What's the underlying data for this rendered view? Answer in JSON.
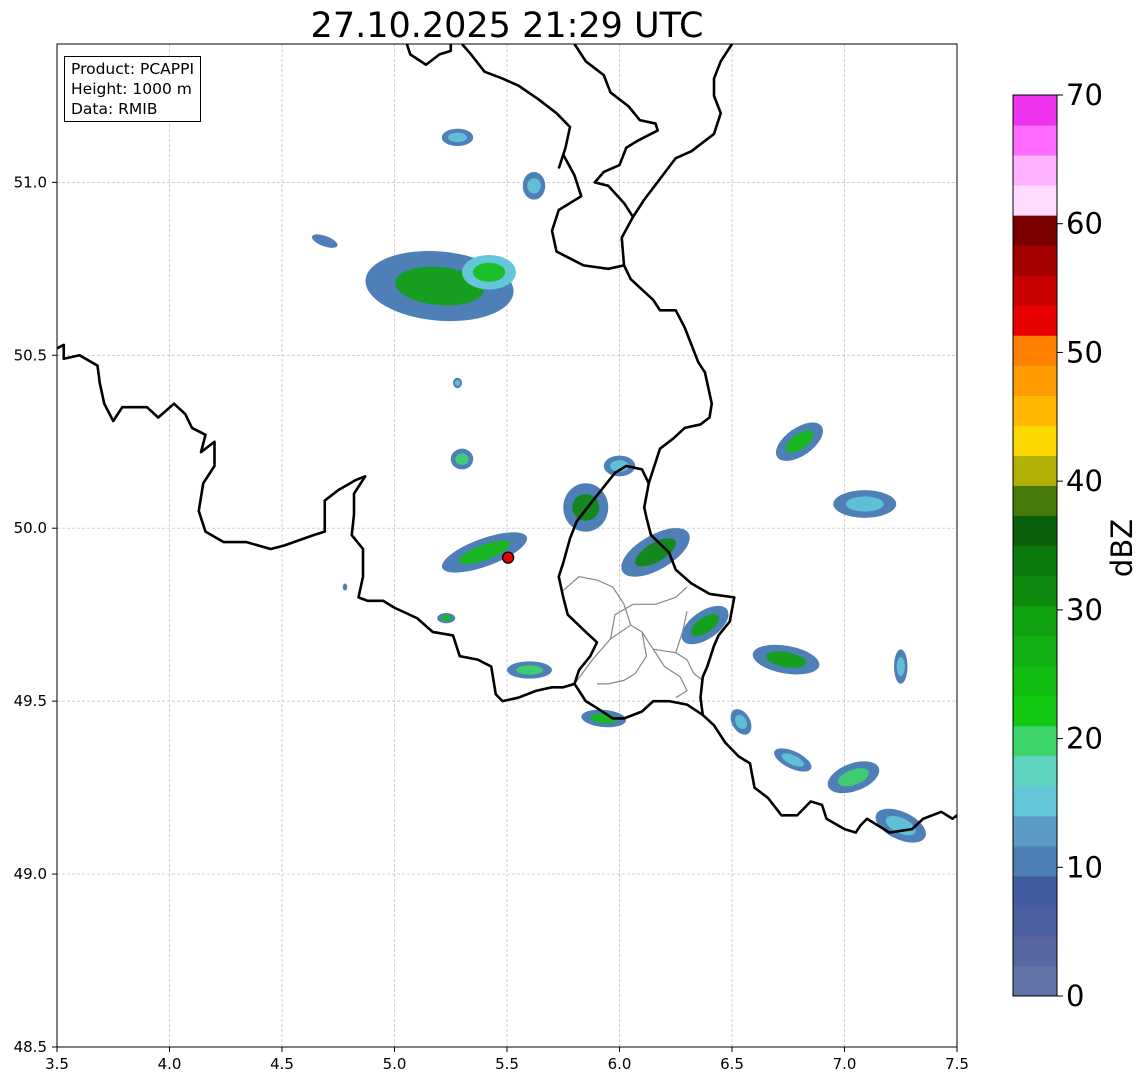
{
  "map": {
    "title": "27.10.2025 21:29 UTC",
    "info": {
      "product": "Product: PCAPPI",
      "height": "Height: 1000 m",
      "data": "Data: RMIB"
    },
    "lon_range": [
      3.5,
      7.5
    ],
    "lat_range": [
      48.5,
      51.4
    ],
    "lon_ticks": [
      3.5,
      4.0,
      4.5,
      5.0,
      5.5,
      6.0,
      6.5,
      7.0,
      7.5
    ],
    "lat_ticks": [
      48.5,
      49.0,
      49.5,
      50.0,
      50.5,
      51.0
    ],
    "grid": true,
    "radar_site": {
      "lon": 5.505,
      "lat": 49.915,
      "color": "#e60000"
    },
    "borders": [
      [
        [
          3.5,
          50.52
        ],
        [
          3.53,
          50.53
        ],
        [
          3.53,
          50.49
        ],
        [
          3.6,
          50.5
        ],
        [
          3.68,
          50.47
        ],
        [
          3.69,
          50.42
        ],
        [
          3.71,
          50.36
        ],
        [
          3.75,
          50.31
        ],
        [
          3.79,
          50.35
        ],
        [
          3.9,
          50.35
        ],
        [
          3.95,
          50.32
        ],
        [
          4.02,
          50.36
        ],
        [
          4.07,
          50.33
        ],
        [
          4.1,
          50.29
        ],
        [
          4.16,
          50.27
        ],
        [
          4.14,
          50.22
        ],
        [
          4.2,
          50.25
        ],
        [
          4.2,
          50.18
        ],
        [
          4.15,
          50.13
        ],
        [
          4.13,
          50.05
        ],
        [
          4.16,
          49.99
        ],
        [
          4.24,
          49.96
        ],
        [
          4.34,
          49.96
        ],
        [
          4.45,
          49.94
        ],
        [
          4.51,
          49.95
        ],
        [
          4.64,
          49.98
        ],
        [
          4.69,
          49.99
        ],
        [
          4.69,
          50.08
        ],
        [
          4.75,
          50.11
        ],
        [
          4.83,
          50.14
        ],
        [
          4.87,
          50.15
        ],
        [
          4.82,
          50.1
        ],
        [
          4.82,
          50.04
        ],
        [
          4.81,
          49.98
        ],
        [
          4.86,
          49.94
        ],
        [
          4.86,
          49.86
        ],
        [
          4.84,
          49.8
        ],
        [
          4.88,
          49.79
        ],
        [
          4.95,
          49.79
        ],
        [
          5.0,
          49.77
        ],
        [
          5.1,
          49.74
        ],
        [
          5.17,
          49.7
        ],
        [
          5.26,
          49.69
        ],
        [
          5.29,
          49.63
        ],
        [
          5.37,
          49.62
        ],
        [
          5.43,
          49.6
        ],
        [
          5.45,
          49.52
        ],
        [
          5.48,
          49.5
        ],
        [
          5.55,
          49.51
        ],
        [
          5.63,
          49.53
        ],
        [
          5.7,
          49.54
        ],
        [
          5.75,
          49.54
        ],
        [
          5.8,
          49.55
        ],
        [
          5.85,
          49.5
        ],
        [
          5.9,
          49.48
        ],
        [
          5.97,
          49.45
        ],
        [
          6.02,
          49.45
        ],
        [
          6.1,
          49.47
        ],
        [
          6.15,
          49.5
        ],
        [
          6.22,
          49.5
        ],
        [
          6.3,
          49.49
        ],
        [
          6.37,
          49.46
        ],
        [
          6.42,
          49.43
        ],
        [
          6.47,
          49.38
        ],
        [
          6.53,
          49.34
        ],
        [
          6.58,
          49.32
        ],
        [
          6.6,
          49.25
        ],
        [
          6.66,
          49.22
        ],
        [
          6.72,
          49.17
        ],
        [
          6.79,
          49.17
        ],
        [
          6.85,
          49.21
        ],
        [
          6.9,
          49.2
        ],
        [
          6.92,
          49.16
        ],
        [
          7.0,
          49.13
        ],
        [
          7.05,
          49.12
        ],
        [
          7.07,
          49.14
        ],
        [
          7.1,
          49.16
        ],
        [
          7.2,
          49.12
        ],
        [
          7.3,
          49.13
        ],
        [
          7.35,
          49.16
        ],
        [
          7.43,
          49.18
        ],
        [
          7.48,
          49.16
        ],
        [
          7.5,
          49.17
        ]
      ],
      [
        [
          5.8,
          51.4
        ],
        [
          5.85,
          51.35
        ],
        [
          5.93,
          51.31
        ],
        [
          5.96,
          51.26
        ],
        [
          6.04,
          51.22
        ],
        [
          6.09,
          51.18
        ],
        [
          6.16,
          51.17
        ],
        [
          6.17,
          51.15
        ],
        [
          6.08,
          51.12
        ],
        [
          6.03,
          51.1
        ],
        [
          6.0,
          51.05
        ],
        [
          5.93,
          51.03
        ],
        [
          5.89,
          51.0
        ],
        [
          5.95,
          50.99
        ],
        [
          6.02,
          50.94
        ],
        [
          6.06,
          50.9
        ],
        [
          6.01,
          50.84
        ],
        [
          6.02,
          50.76
        ],
        [
          6.05,
          50.72
        ],
        [
          6.15,
          50.66
        ],
        [
          6.18,
          50.63
        ],
        [
          6.25,
          50.63
        ],
        [
          6.29,
          50.58
        ],
        [
          6.35,
          50.48
        ],
        [
          6.38,
          50.45
        ],
        [
          6.41,
          50.36
        ],
        [
          6.4,
          50.32
        ],
        [
          6.36,
          50.3
        ],
        [
          6.29,
          50.29
        ],
        [
          6.24,
          50.26
        ],
        [
          6.18,
          50.23
        ],
        [
          6.15,
          50.17
        ],
        [
          6.13,
          50.13
        ],
        [
          6.11,
          50.06
        ],
        [
          6.12,
          50.03
        ],
        [
          6.14,
          49.98
        ],
        [
          6.22,
          49.93
        ],
        [
          6.25,
          49.88
        ],
        [
          6.32,
          49.84
        ],
        [
          6.4,
          49.81
        ],
        [
          6.51,
          49.8
        ],
        [
          6.49,
          49.73
        ],
        [
          6.44,
          49.69
        ],
        [
          6.42,
          49.66
        ],
        [
          6.39,
          49.6
        ],
        [
          6.37,
          49.57
        ],
        [
          6.36,
          49.51
        ],
        [
          6.37,
          49.46
        ]
      ],
      [
        [
          5.8,
          49.55
        ],
        [
          5.82,
          49.59
        ],
        [
          5.87,
          49.63
        ],
        [
          5.9,
          49.67
        ],
        [
          5.85,
          49.7
        ],
        [
          5.77,
          49.75
        ],
        [
          5.75,
          49.8
        ],
        [
          5.73,
          49.86
        ],
        [
          5.75,
          49.9
        ],
        [
          5.78,
          49.97
        ],
        [
          5.81,
          50.02
        ],
        [
          5.87,
          50.07
        ],
        [
          5.98,
          50.16
        ],
        [
          6.03,
          50.18
        ],
        [
          6.1,
          50.17
        ],
        [
          6.13,
          50.13
        ]
      ],
      [
        [
          5.25,
          51.4
        ],
        [
          5.25,
          51.38
        ],
        [
          5.2,
          51.37
        ],
        [
          5.14,
          51.34
        ],
        [
          5.07,
          51.37
        ],
        [
          5.04,
          51.43
        ]
      ],
      [
        [
          5.3,
          51.4
        ],
        [
          5.34,
          51.37
        ],
        [
          5.4,
          51.32
        ],
        [
          5.48,
          51.3
        ],
        [
          5.55,
          51.28
        ],
        [
          5.64,
          51.24
        ],
        [
          5.72,
          51.2
        ],
        [
          5.78,
          51.16
        ],
        [
          5.76,
          51.1
        ],
        [
          5.73,
          51.04
        ]
      ],
      [
        [
          5.75,
          51.08
        ],
        [
          5.8,
          51.02
        ],
        [
          5.83,
          50.96
        ],
        [
          5.73,
          50.92
        ],
        [
          5.7,
          50.86
        ],
        [
          5.72,
          50.8
        ],
        [
          5.78,
          50.78
        ],
        [
          5.84,
          50.76
        ],
        [
          5.95,
          50.75
        ],
        [
          6.02,
          50.76
        ]
      ],
      [
        [
          6.5,
          51.4
        ],
        [
          6.45,
          51.35
        ],
        [
          6.42,
          51.3
        ],
        [
          6.42,
          51.25
        ],
        [
          6.45,
          51.2
        ],
        [
          6.42,
          51.14
        ],
        [
          6.32,
          51.09
        ],
        [
          6.25,
          51.07
        ],
        [
          6.18,
          51.01
        ],
        [
          6.11,
          50.95
        ],
        [
          6.06,
          50.9
        ]
      ]
    ],
    "admin_lines": [
      [
        [
          5.8,
          49.55
        ],
        [
          5.88,
          49.62
        ],
        [
          5.96,
          49.68
        ],
        [
          6.05,
          49.72
        ],
        [
          6.1,
          49.7
        ],
        [
          6.15,
          49.65
        ],
        [
          6.25,
          49.64
        ],
        [
          6.3,
          49.62
        ],
        [
          6.33,
          49.58
        ],
        [
          6.37,
          49.56
        ]
      ],
      [
        [
          6.05,
          49.72
        ],
        [
          6.02,
          49.78
        ],
        [
          5.97,
          49.83
        ],
        [
          5.9,
          49.85
        ],
        [
          5.82,
          49.86
        ],
        [
          5.75,
          49.82
        ]
      ],
      [
        [
          6.1,
          49.7
        ],
        [
          6.12,
          49.63
        ],
        [
          6.07,
          49.58
        ],
        [
          6.02,
          49.56
        ],
        [
          5.95,
          49.55
        ],
        [
          5.9,
          49.55
        ]
      ],
      [
        [
          6.15,
          49.65
        ],
        [
          6.2,
          49.6
        ],
        [
          6.27,
          49.57
        ],
        [
          6.3,
          49.53
        ],
        [
          6.25,
          49.51
        ]
      ],
      [
        [
          5.96,
          49.68
        ],
        [
          5.98,
          49.75
        ],
        [
          6.06,
          49.78
        ],
        [
          6.16,
          49.78
        ],
        [
          6.25,
          49.8
        ],
        [
          6.3,
          49.83
        ]
      ],
      [
        [
          6.25,
          49.64
        ],
        [
          6.28,
          49.7
        ],
        [
          6.3,
          49.76
        ]
      ]
    ],
    "echoes": [
      {
        "lon": 5.28,
        "lat": 51.13,
        "rx": 0.07,
        "ry": 0.025,
        "angle": 0,
        "color": "#4e7fb6",
        "core": "#63c6d9"
      },
      {
        "lon": 5.62,
        "lat": 50.99,
        "rx": 0.05,
        "ry": 0.04,
        "angle": 0,
        "color": "#4e7fb6",
        "core": "#63c6d9"
      },
      {
        "lon": 4.69,
        "lat": 50.83,
        "rx": 0.06,
        "ry": 0.015,
        "angle": 20,
        "color": "#4e7fb6",
        "core": "#4e7fb6"
      },
      {
        "lon": 5.2,
        "lat": 50.7,
        "rx": 0.33,
        "ry": 0.1,
        "angle": 5,
        "color": "#4e7fb6",
        "core": "#10a210"
      },
      {
        "lon": 5.42,
        "lat": 50.74,
        "rx": 0.12,
        "ry": 0.05,
        "angle": 0,
        "color": "#63c6d9",
        "core": "#13be13"
      },
      {
        "lon": 5.28,
        "lat": 50.42,
        "rx": 0.02,
        "ry": 0.015,
        "angle": 0,
        "color": "#4e7fb6",
        "core": "#63c6d9"
      },
      {
        "lon": 5.3,
        "lat": 50.2,
        "rx": 0.05,
        "ry": 0.03,
        "angle": 0,
        "color": "#4e7fb6",
        "core": "#3dd56a"
      },
      {
        "lon": 5.4,
        "lat": 49.93,
        "rx": 0.2,
        "ry": 0.04,
        "angle": -20,
        "color": "#4e7fb6",
        "core": "#13be13"
      },
      {
        "lon": 5.85,
        "lat": 50.06,
        "rx": 0.1,
        "ry": 0.07,
        "angle": 0,
        "color": "#4e7fb6",
        "core": "#0e8a0e"
      },
      {
        "lon": 6.0,
        "lat": 50.18,
        "rx": 0.07,
        "ry": 0.03,
        "angle": 0,
        "color": "#4e7fb6",
        "core": "#63c6d9"
      },
      {
        "lon": 6.16,
        "lat": 49.93,
        "rx": 0.17,
        "ry": 0.05,
        "angle": -30,
        "color": "#4e7fb6",
        "core": "#0e8a0e"
      },
      {
        "lon": 6.38,
        "lat": 49.72,
        "rx": 0.12,
        "ry": 0.04,
        "angle": -35,
        "color": "#4e7fb6",
        "core": "#10a210"
      },
      {
        "lon": 5.6,
        "lat": 49.59,
        "rx": 0.1,
        "ry": 0.025,
        "angle": 0,
        "color": "#4e7fb6",
        "core": "#3dd56a"
      },
      {
        "lon": 5.23,
        "lat": 49.74,
        "rx": 0.04,
        "ry": 0.015,
        "angle": 0,
        "color": "#4e7fb6",
        "core": "#13be13"
      },
      {
        "lon": 5.93,
        "lat": 49.45,
        "rx": 0.1,
        "ry": 0.025,
        "angle": 5,
        "color": "#4e7fb6",
        "core": "#13be13"
      },
      {
        "lon": 6.8,
        "lat": 50.25,
        "rx": 0.12,
        "ry": 0.04,
        "angle": -35,
        "color": "#4e7fb6",
        "core": "#13be13"
      },
      {
        "lon": 7.09,
        "lat": 50.07,
        "rx": 0.14,
        "ry": 0.04,
        "angle": 0,
        "color": "#4e7fb6",
        "core": "#63c6d9"
      },
      {
        "lon": 6.74,
        "lat": 49.62,
        "rx": 0.15,
        "ry": 0.04,
        "angle": 10,
        "color": "#4e7fb6",
        "core": "#10a210"
      },
      {
        "lon": 7.25,
        "lat": 49.6,
        "rx": 0.03,
        "ry": 0.05,
        "angle": 0,
        "color": "#4e7fb6",
        "core": "#63c6d9"
      },
      {
        "lon": 6.54,
        "lat": 49.44,
        "rx": 0.04,
        "ry": 0.04,
        "angle": -30,
        "color": "#4e7fb6",
        "core": "#63c6d9"
      },
      {
        "lon": 6.77,
        "lat": 49.33,
        "rx": 0.09,
        "ry": 0.025,
        "angle": 25,
        "color": "#4e7fb6",
        "core": "#63c6d9"
      },
      {
        "lon": 7.04,
        "lat": 49.28,
        "rx": 0.12,
        "ry": 0.04,
        "angle": -20,
        "color": "#4e7fb6",
        "core": "#3dd56a"
      },
      {
        "lon": 7.25,
        "lat": 49.14,
        "rx": 0.12,
        "ry": 0.04,
        "angle": 25,
        "color": "#4e7fb6",
        "core": "#63c6d9"
      },
      {
        "lon": 4.78,
        "lat": 49.83,
        "rx": 0.01,
        "ry": 0.01,
        "angle": 0,
        "color": "#4e7fb6",
        "core": "#4e7fb6"
      }
    ]
  },
  "colorbar": {
    "label": "dBZ",
    "ticks": [
      "0",
      "10",
      "20",
      "30",
      "40",
      "50",
      "60",
      "70"
    ],
    "range": [
      0,
      70
    ],
    "step": 2.5,
    "colors": [
      "#6574a8",
      "#5867a2",
      "#4a5ea0",
      "#425d9f",
      "#4e7fb6",
      "#5a9ac3",
      "#63c6d9",
      "#5fd5c0",
      "#3dd56a",
      "#13c813",
      "#13be13",
      "#12b012",
      "#10a210",
      "#0e8a0e",
      "#0b7a0b",
      "#0a600a",
      "#477a0a",
      "#b0b005",
      "#ffd700",
      "#ffb700",
      "#ff9a00",
      "#ff7f00",
      "#e80000",
      "#c90000",
      "#a50000",
      "#7a0000",
      "#ffdcff",
      "#ffb2ff",
      "#ff6aff",
      "#ee33ee"
    ]
  }
}
